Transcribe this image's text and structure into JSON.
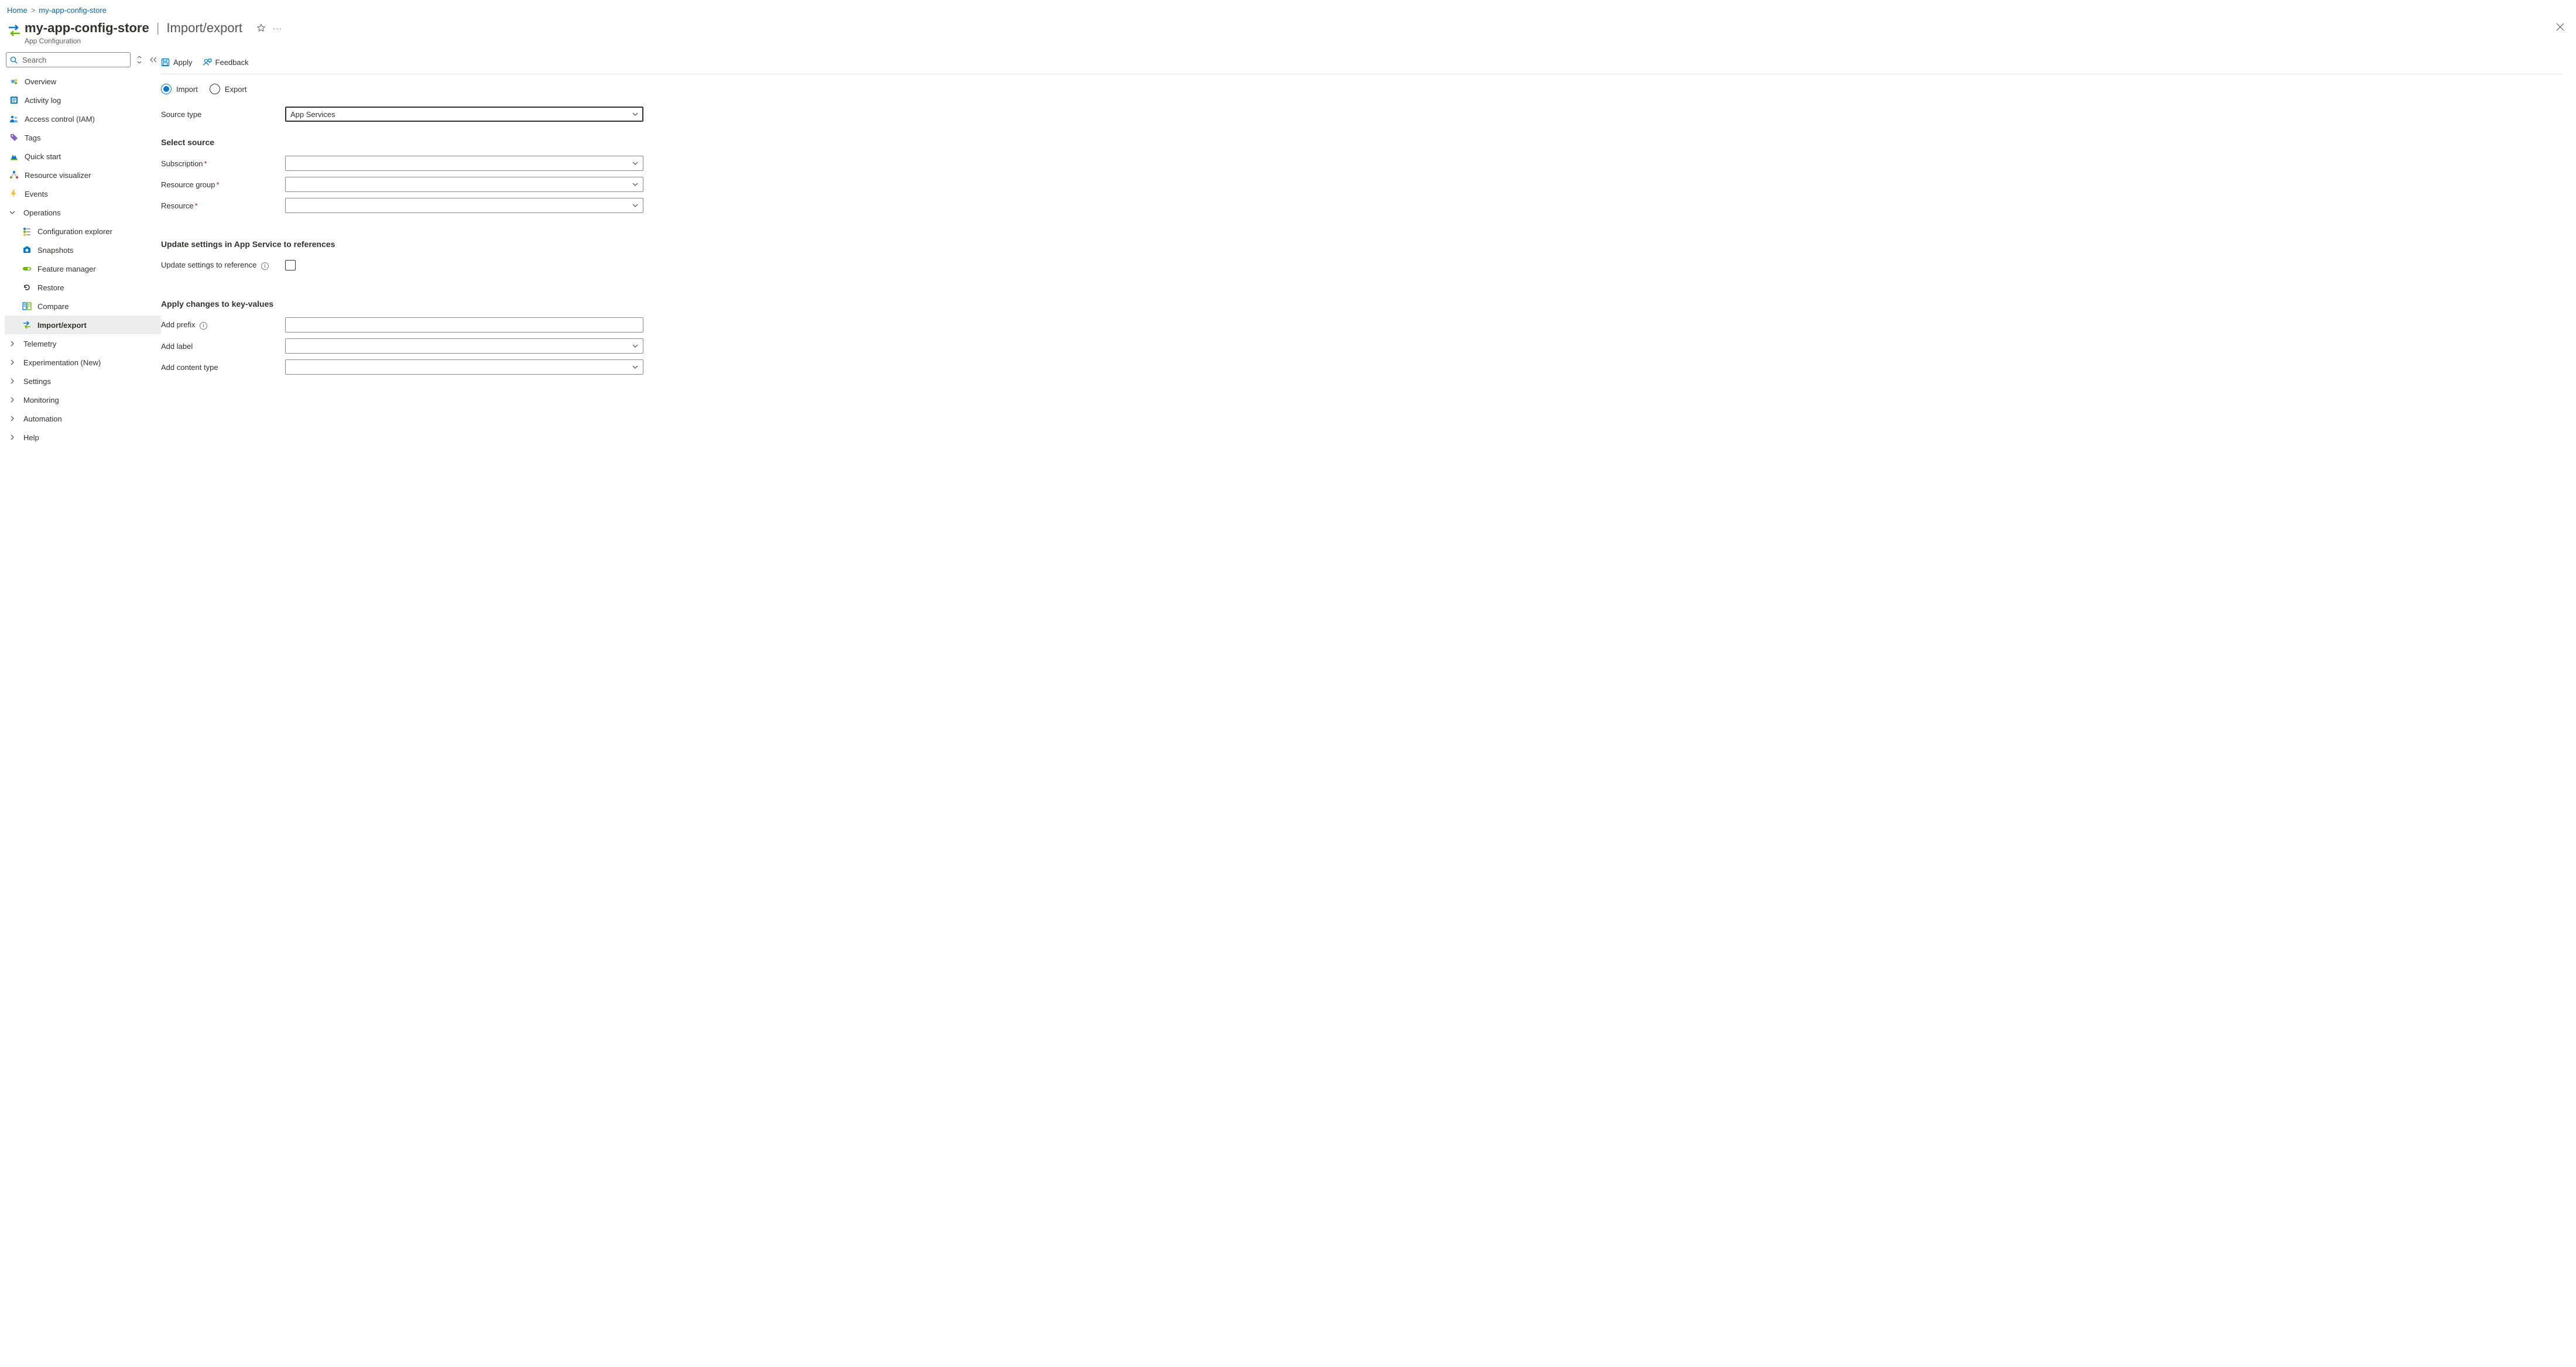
{
  "breadcrumb": {
    "home": "Home",
    "resource": "my-app-config-store"
  },
  "header": {
    "name": "my-app-config-store",
    "section": "Import/export",
    "subtitle": "App Configuration"
  },
  "sidebar": {
    "searchPlaceholder": "Search",
    "items": {
      "overview": "Overview",
      "activity": "Activity log",
      "iam": "Access control (IAM)",
      "tags": "Tags",
      "quickstart": "Quick start",
      "visualizer": "Resource visualizer",
      "events": "Events",
      "operations": "Operations",
      "configExplorer": "Configuration explorer",
      "snapshots": "Snapshots",
      "featureManager": "Feature manager",
      "restore": "Restore",
      "compare": "Compare",
      "importExport": "Import/export",
      "telemetry": "Telemetry",
      "experimentation": "Experimentation (New)",
      "settings": "Settings",
      "monitoring": "Monitoring",
      "automation": "Automation",
      "help": "Help"
    }
  },
  "toolbar": {
    "apply": "Apply",
    "feedback": "Feedback"
  },
  "form": {
    "radioImport": "Import",
    "radioExport": "Export",
    "sourceTypeLabel": "Source type",
    "sourceTypeValue": "App Services",
    "selectSourceHeading": "Select source",
    "subscriptionLabel": "Subscription",
    "resourceGroupLabel": "Resource group",
    "resourceLabel": "Resource",
    "updateSettingsHeading": "Update settings in App Service to references",
    "updateSettingsLabel": "Update settings to reference",
    "applyChangesHeading": "Apply changes to key-values",
    "addPrefixLabel": "Add prefix",
    "addLabelLabel": "Add label",
    "addContentTypeLabel": "Add content type"
  }
}
